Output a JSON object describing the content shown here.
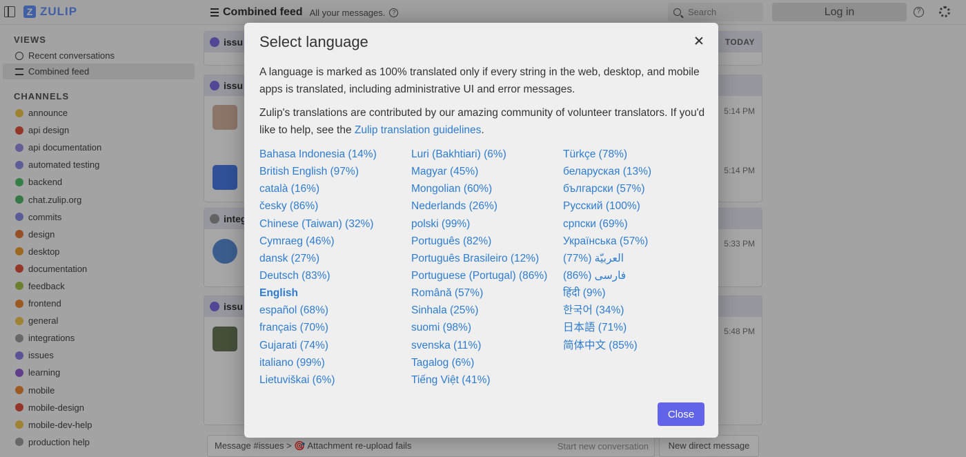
{
  "header": {
    "logo_text": "ZULIP",
    "logo_letter": "Z",
    "feed_title": "Combined feed",
    "feed_subtitle": "All your messages.",
    "help_glyph": "?",
    "search_placeholder": "Search",
    "login_label": "Log in"
  },
  "sidebar": {
    "views_heading": "VIEWS",
    "views": [
      {
        "label": "Recent conversations",
        "icon": "clock-icon"
      },
      {
        "label": "Combined feed",
        "icon": "lines-icon"
      }
    ],
    "channels_heading": "CHANNELS",
    "channels": [
      {
        "label": "announce",
        "color": "#f5c94e"
      },
      {
        "label": "api design",
        "color": "#e4523d"
      },
      {
        "label": "api documentation",
        "color": "#9b8fe5"
      },
      {
        "label": "automated testing",
        "color": "#8f8fe8"
      },
      {
        "label": "backend",
        "color": "#52c26a"
      },
      {
        "label": "chat.zulip.org",
        "color": "#53b86a"
      },
      {
        "label": "commits",
        "color": "#8a8ee8"
      },
      {
        "label": "design",
        "color": "#e87b3a"
      },
      {
        "label": "desktop",
        "color": "#f0a030"
      },
      {
        "label": "documentation",
        "color": "#e4523d"
      },
      {
        "label": "feedback",
        "color": "#a6c64a"
      },
      {
        "label": "frontend",
        "color": "#f08a36"
      },
      {
        "label": "general",
        "color": "#f5c94e"
      },
      {
        "label": "integrations",
        "color": "#a0a0a0"
      },
      {
        "label": "issues",
        "color": "#8a7de6"
      },
      {
        "label": "learning",
        "color": "#9560d8"
      },
      {
        "label": "mobile",
        "color": "#f08a36"
      },
      {
        "label": "mobile-design",
        "color": "#e4523d"
      },
      {
        "label": "mobile-dev-help",
        "color": "#f5c94e"
      },
      {
        "label": "production help",
        "color": "#a0a0a0"
      }
    ]
  },
  "feed": {
    "cards": [
      {
        "topic": "issu",
        "meta": "TODAY"
      },
      {
        "topic": "issu",
        "times": [
          "5:14 PM",
          "5:14 PM"
        ]
      },
      {
        "topic": "integ",
        "times": [
          "5:33 PM"
        ]
      },
      {
        "topic": "issu",
        "times": [
          "5:48 PM"
        ]
      }
    ],
    "composer_target": "Message #issues > 🎯 Attachment re-upload fails",
    "start_new": "Start new conversation",
    "new_dm": "New direct message"
  },
  "modal": {
    "title": "Select language",
    "paragraph1": "A language is marked as 100% translated only if every string in the web, desktop, and mobile apps is translated, including administrative UI and error messages.",
    "paragraph2_before": "Zulip's translations are contributed by our amazing community of volunteer translators. If you'd like to help, see the ",
    "paragraph2_link": "Zulip translation guidelines",
    "paragraph2_after": ".",
    "languages": [
      "Bahasa Indonesia (14%)",
      "British English (97%)",
      "català (16%)",
      "česky (86%)",
      "Chinese (Taiwan) (32%)",
      "Cymraeg (46%)",
      "dansk (27%)",
      "Deutsch (83%)",
      "English",
      "español (68%)",
      "français (70%)",
      "Gujarati (74%)",
      "italiano (99%)",
      "Lietuviškai (6%)",
      "Luri (Bakhtiari) (6%)",
      "Magyar (45%)",
      "Mongolian (60%)",
      "Nederlands (26%)",
      "polski (99%)",
      "Português (82%)",
      "Português Brasileiro (12%)",
      "Portuguese (Portugal) (86%)",
      "Română (57%)",
      "Sinhala (25%)",
      "suomi (98%)",
      "svenska (11%)",
      "Tagalog (6%)",
      "Tiếng Việt (41%)",
      "Türkçe (78%)",
      "беларуская (13%)",
      "български (57%)",
      "Русский (100%)",
      "српски (69%)",
      "Українська (57%)",
      "العربيّة (%77)",
      "فارسی (%86)",
      "हिंदी (9%)",
      "한국어 (34%)",
      "日本語 (71%)",
      "简体中文 (85%)"
    ],
    "current_language": "English",
    "close_label": "Close"
  }
}
